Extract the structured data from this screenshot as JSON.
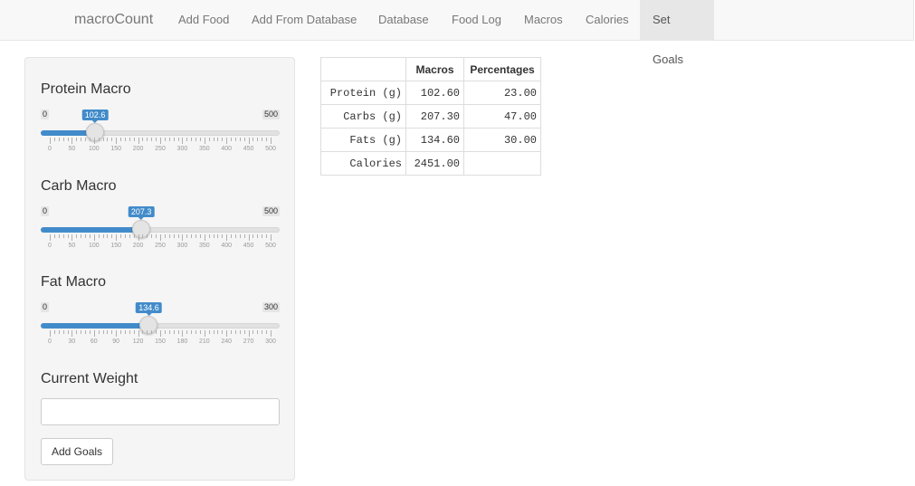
{
  "nav": {
    "brand": "macroCount",
    "items": [
      {
        "label": "Add Food",
        "active": false
      },
      {
        "label": "Add From Database",
        "active": false
      },
      {
        "label": "Database",
        "active": false
      },
      {
        "label": "Food Log",
        "active": false
      },
      {
        "label": "Macros",
        "active": false
      },
      {
        "label": "Calories",
        "active": false
      },
      {
        "label": "Set Goals",
        "active": true
      }
    ]
  },
  "sliders": {
    "protein": {
      "label": "Protein Macro",
      "min": "0",
      "max": "500",
      "value": "102.6",
      "ticks": [
        "0",
        "50",
        "100",
        "150",
        "200",
        "250",
        "300",
        "350",
        "400",
        "450",
        "500"
      ]
    },
    "carb": {
      "label": "Carb Macro",
      "min": "0",
      "max": "500",
      "value": "207.3",
      "ticks": [
        "0",
        "50",
        "100",
        "150",
        "200",
        "250",
        "300",
        "350",
        "400",
        "450",
        "500"
      ]
    },
    "fat": {
      "label": "Fat Macro",
      "min": "0",
      "max": "300",
      "value": "134.6",
      "ticks": [
        "0",
        "30",
        "60",
        "90",
        "120",
        "150",
        "180",
        "210",
        "240",
        "270",
        "300"
      ]
    }
  },
  "weight": {
    "label": "Current Weight",
    "value": "",
    "placeholder": ""
  },
  "add_goals_label": "Add Goals",
  "table": {
    "headers": [
      "",
      "Macros",
      "Percentages"
    ],
    "rows": [
      [
        "Protein (g)",
        "102.60",
        "23.00"
      ],
      [
        "Carbs (g)",
        "207.30",
        "47.00"
      ],
      [
        "Fats (g)",
        "134.60",
        "30.00"
      ],
      [
        "Calories",
        "2451.00",
        ""
      ]
    ]
  },
  "colors": {
    "accent": "#428bca",
    "navbar_bg": "#f8f8f8",
    "well_bg": "#f5f5f5"
  }
}
